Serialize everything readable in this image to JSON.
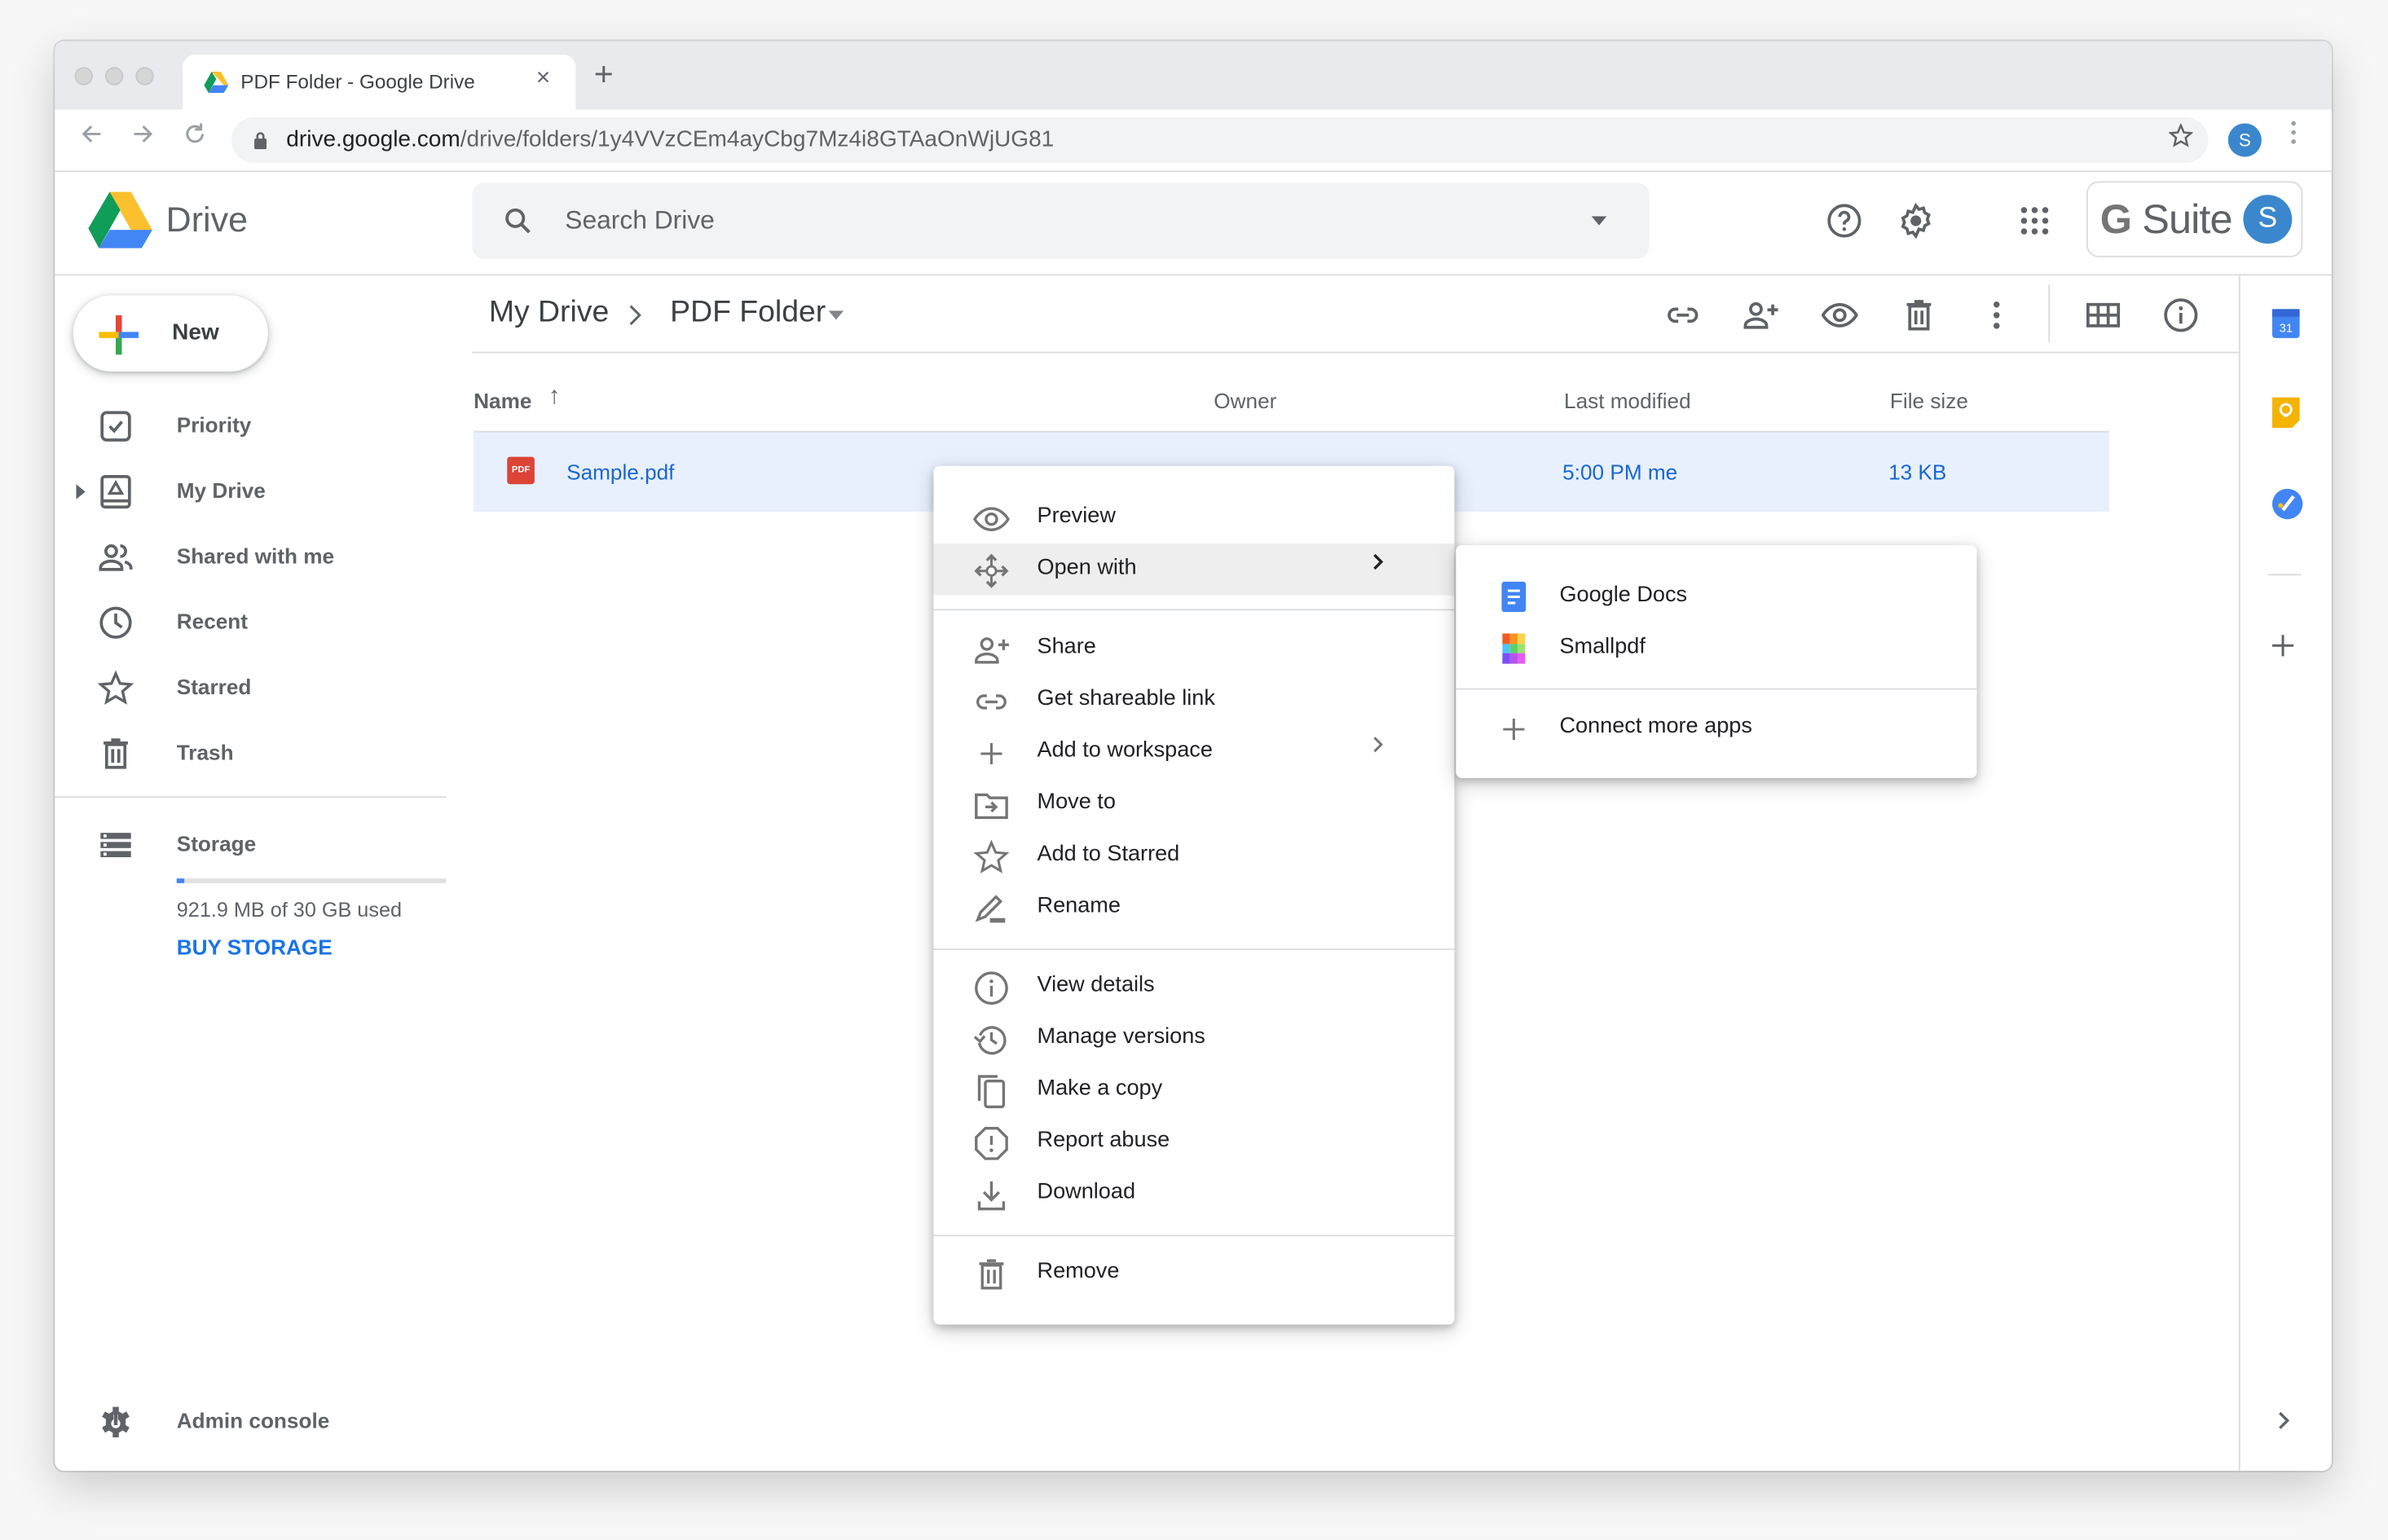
{
  "browser": {
    "tab_title": "PDF Folder - Google Drive",
    "tab_close": "×",
    "new_tab": "+",
    "url_domain": "drive.google.com",
    "url_path": "/drive/folders/1y4VVzCEm4ayCbg7Mz4i8GTAaOnWjUG81",
    "profile_initial": "S",
    "icons": [
      "back-icon",
      "forward-icon",
      "reload-icon",
      "lock-icon",
      "bookmark-star-icon",
      "menu-kebab-icon"
    ]
  },
  "header": {
    "app_name": "Drive",
    "search_placeholder": "Search Drive",
    "gsuite_label": "Suite",
    "gsuite_g": "G",
    "account_initial": "S",
    "icons": [
      "help-icon",
      "settings-icon",
      "apps-grid-icon"
    ]
  },
  "sidebar": {
    "new_label": "New",
    "items": [
      {
        "label": "Priority",
        "icon": "priority-check-icon"
      },
      {
        "label": "My Drive",
        "icon": "my-drive-icon",
        "expandable": true
      },
      {
        "label": "Shared with me",
        "icon": "shared-people-icon"
      },
      {
        "label": "Recent",
        "icon": "clock-icon"
      },
      {
        "label": "Starred",
        "icon": "star-icon"
      },
      {
        "label": "Trash",
        "icon": "trash-icon"
      }
    ],
    "storage": {
      "label": "Storage",
      "used_text": "921.9 MB of 30 GB used",
      "used_fraction": 0.03,
      "buy_label": "BUY STORAGE"
    },
    "admin_label": "Admin console"
  },
  "main": {
    "breadcrumb": [
      {
        "label": "My Drive"
      },
      {
        "label": "PDF Folder"
      }
    ],
    "breadcrumb_separator": "›",
    "toolbar_icons": [
      "get-link-icon",
      "share-add-person-icon",
      "preview-eye-icon",
      "remove-trash-icon",
      "more-actions-icon",
      "grid-view-icon",
      "details-info-icon"
    ],
    "columns": {
      "name": "Name",
      "sort_indicator": "↑",
      "owner": "Owner",
      "last_modified": "Last modified",
      "file_size": "File size"
    },
    "files": [
      {
        "name": "Sample.pdf",
        "type_badge": "PDF",
        "owner": "",
        "last_modified": "5:00 PM",
        "modified_by": "me",
        "file_size": "13 KB",
        "selected": true
      }
    ]
  },
  "context_menu": {
    "sections": [
      [
        {
          "label": "Preview",
          "icon": "eye-icon"
        },
        {
          "label": "Open with",
          "icon": "open-with-arrows-icon",
          "submenu": true,
          "highlighted": true
        }
      ],
      [
        {
          "label": "Share",
          "icon": "person-add-icon"
        },
        {
          "label": "Get shareable link",
          "icon": "link-icon"
        },
        {
          "label": "Add to workspace",
          "icon": "plus-icon",
          "submenu": true
        },
        {
          "label": "Move to",
          "icon": "move-folder-icon"
        },
        {
          "label": "Add to Starred",
          "icon": "star-outline-icon"
        },
        {
          "label": "Rename",
          "icon": "pencil-icon"
        }
      ],
      [
        {
          "label": "View details",
          "icon": "info-icon"
        },
        {
          "label": "Manage versions",
          "icon": "history-icon"
        },
        {
          "label": "Make a copy",
          "icon": "copy-icon"
        },
        {
          "label": "Report abuse",
          "icon": "report-icon"
        },
        {
          "label": "Download",
          "icon": "download-icon"
        }
      ],
      [
        {
          "label": "Remove",
          "icon": "trash-icon"
        }
      ]
    ],
    "chevron": "›"
  },
  "open_with_submenu": {
    "apps": [
      {
        "label": "Google Docs",
        "icon": "google-docs-icon"
      },
      {
        "label": "Smallpdf",
        "icon": "smallpdf-icon"
      }
    ],
    "connect_label": "Connect more apps"
  },
  "right_panel": {
    "calendar_day": "31",
    "icons": [
      "calendar-icon",
      "keep-icon",
      "tasks-icon",
      "add-addon-icon",
      "expand-panel-icon"
    ],
    "expand_chevron": "›"
  },
  "colors": {
    "accent_blue": "#1a73e8",
    "selection_bg": "#e8f0fe",
    "avatar_blue": "#3b87cd",
    "pdf_red": "#db4437"
  }
}
